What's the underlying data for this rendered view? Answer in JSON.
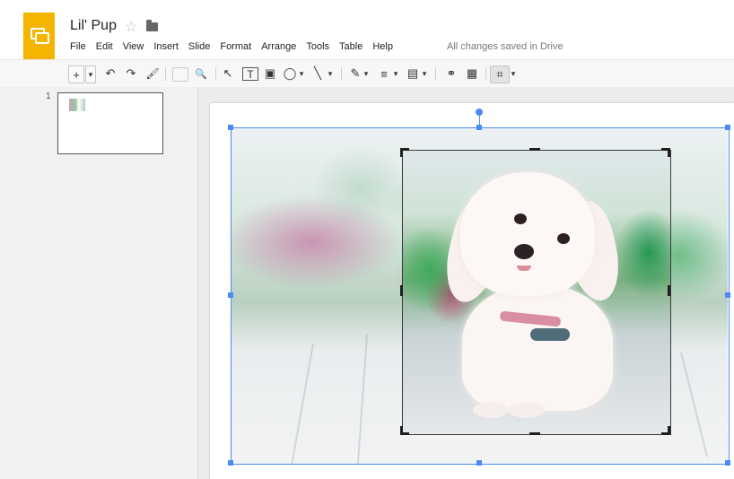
{
  "document": {
    "title": "Lil' Pup",
    "status": "All changes saved in Drive"
  },
  "menu": [
    "File",
    "Edit",
    "View",
    "Insert",
    "Slide",
    "Format",
    "Arrange",
    "Tools",
    "Table",
    "Help"
  ],
  "toolbar": {
    "new_slide": "+",
    "dropdown": "▾",
    "undo": "↶",
    "redo": "↷",
    "paint_format": "🖌",
    "zoom": "🔍",
    "select": "↖",
    "textbox": "T",
    "image": "▣",
    "shape": "◯",
    "line": "╲",
    "pen": "✎",
    "lines_weight": "≡",
    "line_dash": "▤",
    "link": "⚭",
    "comment": "▦",
    "crop": "⌗"
  },
  "slides": {
    "items": [
      {
        "number": "1"
      }
    ]
  },
  "colors": {
    "accent": "#f4b400",
    "selection": "#4a8af4"
  },
  "icons": [
    "slides-logo-icon",
    "star-icon",
    "folder-icon",
    "crop-icon"
  ]
}
